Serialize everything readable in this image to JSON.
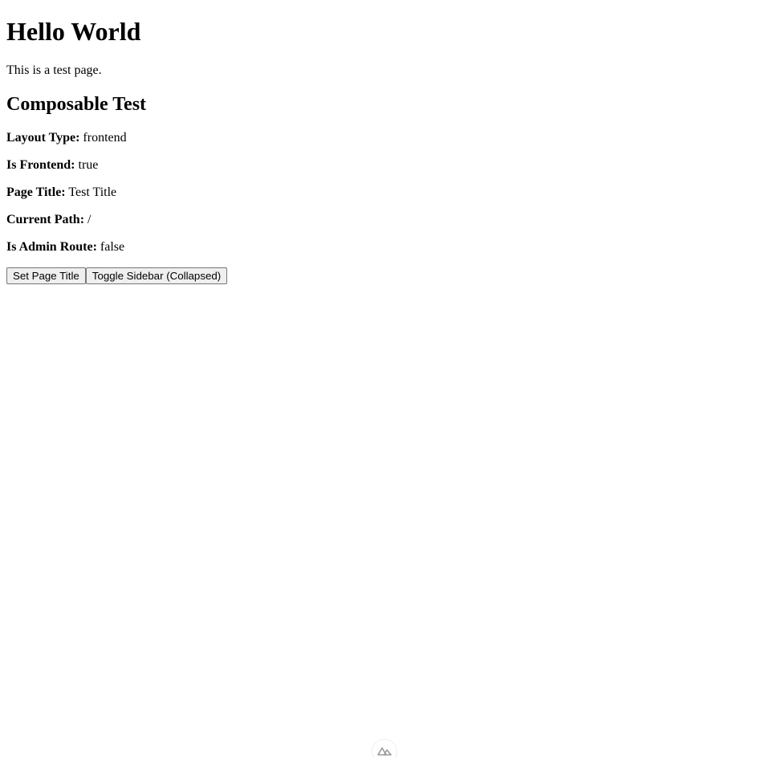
{
  "page": {
    "heading": "Hello World",
    "intro": "This is a test page."
  },
  "composable": {
    "heading": "Composable Test",
    "rows": [
      {
        "label": "Layout Type:",
        "value": "frontend"
      },
      {
        "label": "Is Frontend:",
        "value": "true"
      },
      {
        "label": "Page Title:",
        "value": "Test Title"
      },
      {
        "label": "Current Path:",
        "value": "/"
      },
      {
        "label": "Is Admin Route:",
        "value": "false"
      }
    ]
  },
  "buttons": {
    "set_page_title": "Set Page Title",
    "toggle_sidebar": "Toggle Sidebar (Collapsed)"
  },
  "devtools": {
    "icon": "nuxt-logo-icon"
  }
}
